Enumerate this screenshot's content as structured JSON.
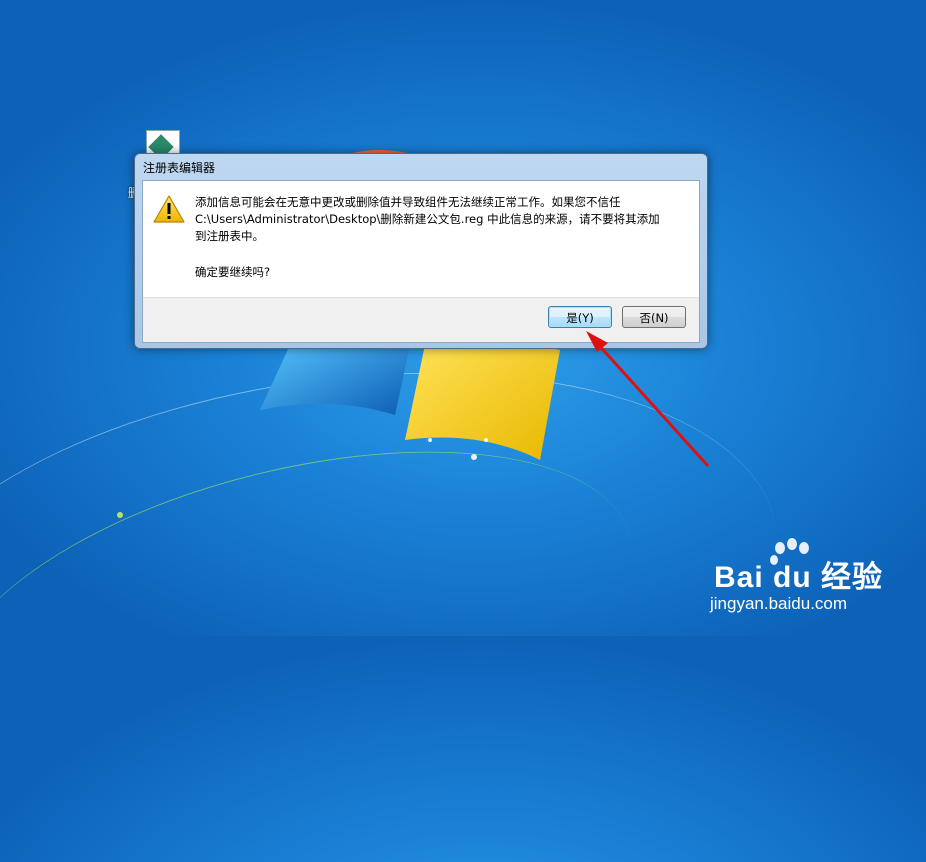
{
  "dialog": {
    "title": "注册表编辑器",
    "message": "添加信息可能会在无意中更改或删除值并导致组件无法继续正常工作。如果您不信任\nC:\\Users\\Administrator\\Desktop\\删除新建公文包.reg 中此信息的来源，请不要将其添加\n到注册表中。",
    "confirm": "确定要继续吗?",
    "yes_label": "是(Y)",
    "no_label": "否(N)"
  },
  "desktop": {
    "icon_name": "reg-file-icon",
    "icon_label_fragment": "删"
  },
  "watermark": {
    "logo_text": "Bai du 经验",
    "url": "jingyan.baidu.com"
  },
  "colors": {
    "desktop_blue": "#1a82d6",
    "arrow_red": "#e01010"
  }
}
